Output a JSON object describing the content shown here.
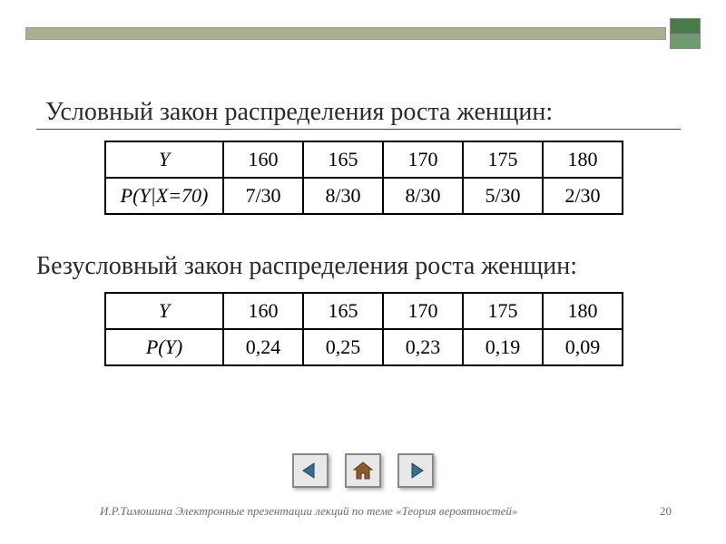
{
  "colors": {
    "olive": "#a7b18f",
    "green_dark": "#4a7a4a",
    "green_light": "#6f9b6f"
  },
  "heading1": "Условный закон распределения роста женщин:",
  "heading2": "Безусловный закон распределения роста женщин:",
  "table1": {
    "row1": {
      "label": "Y",
      "cells": [
        "160",
        "165",
        "170",
        "175",
        "180"
      ]
    },
    "row2": {
      "label": "P(Y|X=70)",
      "cells": [
        "7/30",
        "8/30",
        "8/30",
        "5/30",
        "2/30"
      ]
    }
  },
  "table2": {
    "row1": {
      "label": "Y",
      "cells": [
        "160",
        "165",
        "170",
        "175",
        "180"
      ]
    },
    "row2": {
      "label": "P(Y)",
      "cells": [
        "0,24",
        "0,25",
        "0,23",
        "0,19",
        "0,09"
      ]
    }
  },
  "nav": {
    "prev": "prev",
    "home": "home",
    "next": "next"
  },
  "footer_text": "И.Р.Тимошина Электронные презентации лекций по теме «Теория вероятностей»",
  "page_number": "20"
}
